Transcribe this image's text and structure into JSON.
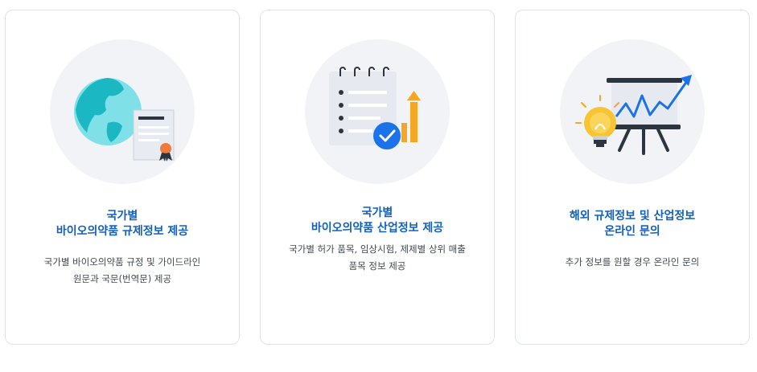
{
  "cards": [
    {
      "title_lines": [
        "국가별",
        "바이오의약품 규제정보 제공"
      ],
      "desc_lines": [
        "국가별 바이오의약품 규정 및 가이드라인",
        "원문과 국문(번역문) 제공"
      ],
      "icon": "globe-certificate-icon"
    },
    {
      "title_lines": [
        "국가별",
        "바이오의약품 산업정보 제공"
      ],
      "desc_lines": [
        "국가별 허가 품목, 임상시험, 제제별 상위 매출",
        "품목 정보 제공"
      ],
      "icon": "checklist-chart-icon"
    },
    {
      "title_lines": [
        "해외 규제정보 및 산업정보",
        "온라인 문의"
      ],
      "desc_lines": [
        "추가 정보를 원할 경우 온라인 문의"
      ],
      "icon": "lightbulb-presentation-icon"
    }
  ],
  "colors": {
    "title": "#1060c0",
    "text": "#444a52",
    "border": "#dfe3e8",
    "illustration_bg": "#f1f3f6",
    "accent_blue": "#1a73e8",
    "accent_orange": "#f5a623",
    "globe": "#25c4d0"
  }
}
